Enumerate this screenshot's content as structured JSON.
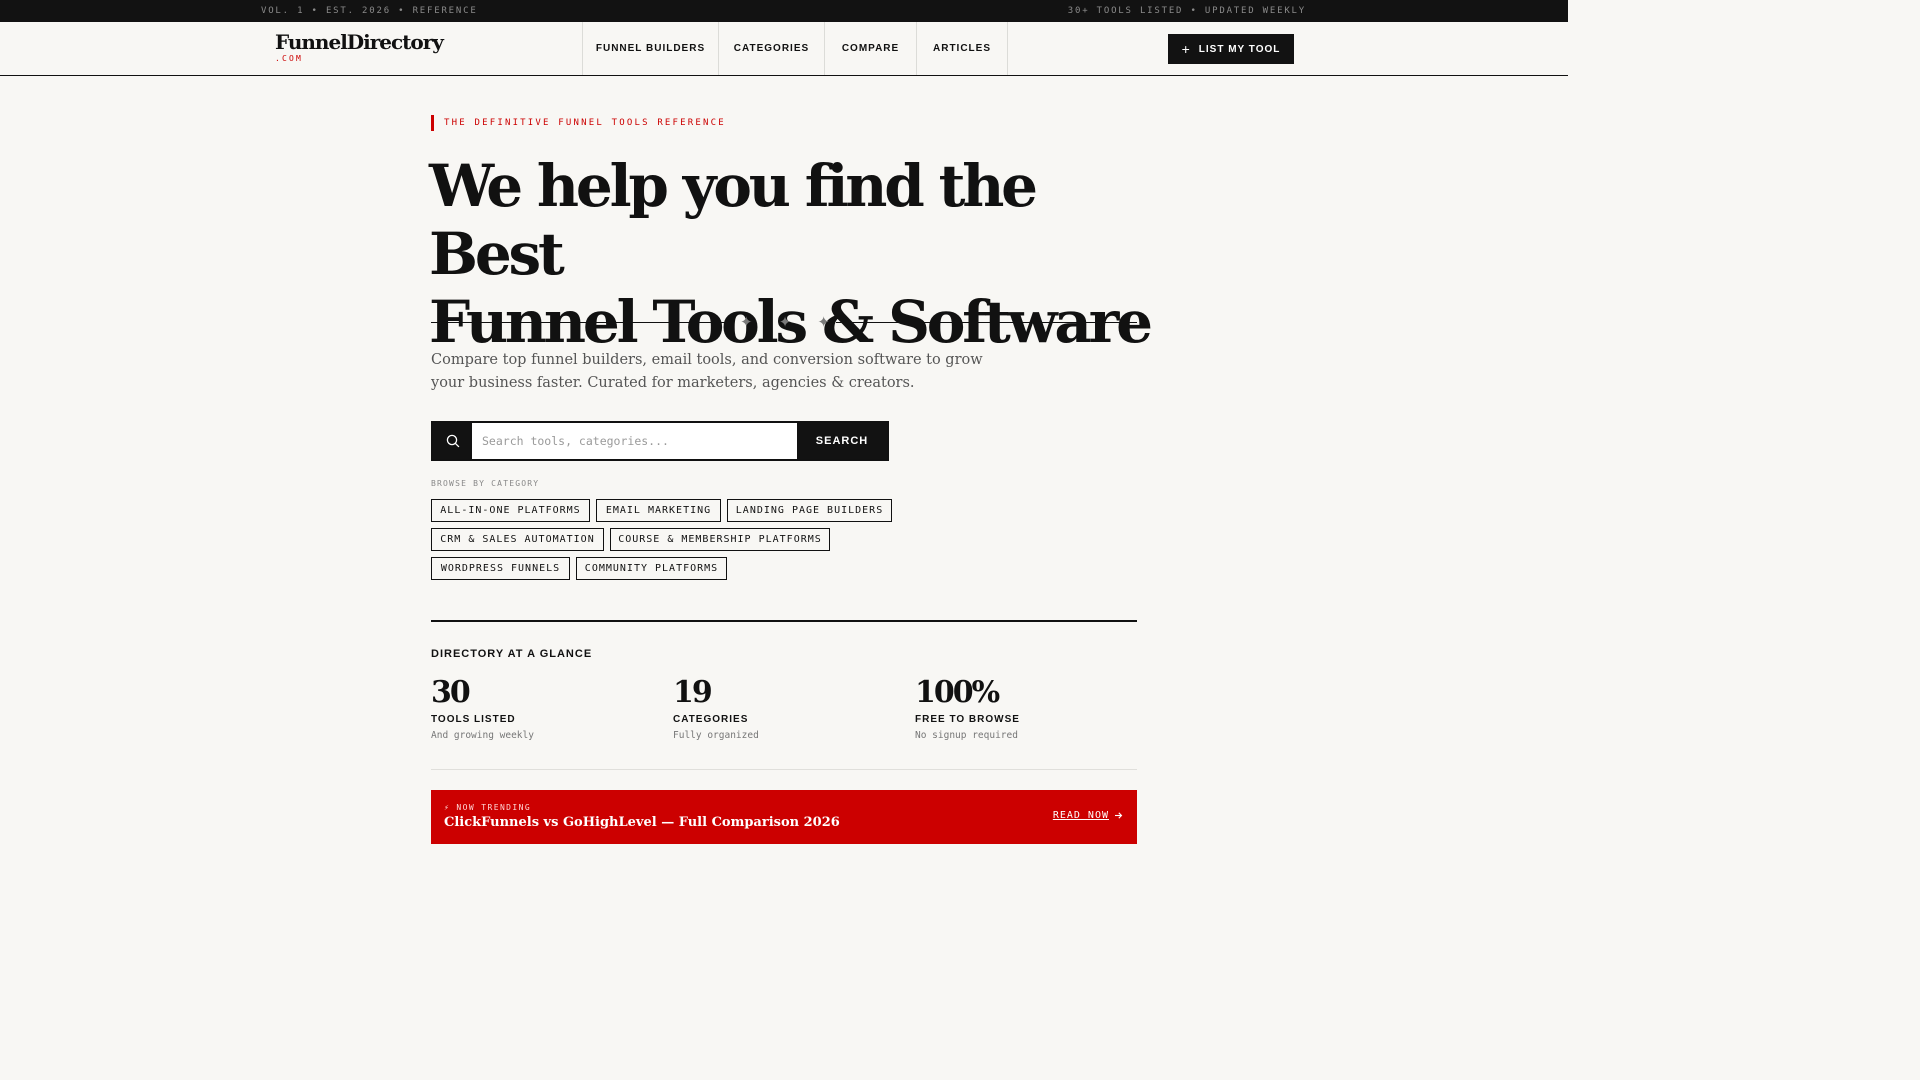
{
  "topbar": {
    "left_text": "VOL. 1 • EST. 2026 • REFERENCE",
    "right_text": "30+ TOOLS LISTED • UPDATED WEEKLY"
  },
  "logo": {
    "name": "FunnelDirectory",
    "domain": ".COM"
  },
  "nav": {
    "items": [
      {
        "label": "FUNNEL BUILDERS"
      },
      {
        "label": "CATEGORIES"
      },
      {
        "label": "COMPARE"
      },
      {
        "label": "ARTICLES"
      }
    ],
    "cta_label": "LIST MY TOOL",
    "cta_icon": "plus-icon"
  },
  "hero": {
    "eyebrow": "THE DEFINITIVE FUNNEL TOOLS REFERENCE",
    "headline_line1": "We help you find the Best",
    "headline_line2": "Funnel Tools & Software",
    "divider_glyphs": [
      "✦",
      "✦",
      "✦"
    ],
    "lede": "Compare top funnel builders, email tools, and conversion software to grow your business faster. Curated for marketers, agencies & creators."
  },
  "search": {
    "icon": "search-icon",
    "placeholder": "Search tools, categories...",
    "value": "",
    "button_label": "SEARCH"
  },
  "browse": {
    "label": "BROWSE BY CATEGORY",
    "categories": [
      "ALL-IN-ONE PLATFORMS",
      "EMAIL MARKETING",
      "LANDING PAGE BUILDERS",
      "CRM & SALES AUTOMATION",
      "COURSE & MEMBERSHIP PLATFORMS",
      "WORDPRESS FUNNELS",
      "COMMUNITY PLATFORMS"
    ]
  },
  "stats": {
    "title": "DIRECTORY AT A GLANCE",
    "items": [
      {
        "value": "30",
        "label": "TOOLS LISTED",
        "sub": "And growing weekly"
      },
      {
        "value": "19",
        "label": "CATEGORIES",
        "sub": "Fully organized"
      },
      {
        "value": "100%",
        "label": "FREE TO BROWSE",
        "sub": "No signup required"
      }
    ]
  },
  "trending": {
    "icon": "lightning-icon",
    "kicker": "⚡ NOW TRENDING",
    "title": "ClickFunnels vs GoHighLevel — Full Comparison 2026",
    "link_label": "READ NOW",
    "link_icon": "arrow-right-icon"
  },
  "colors": {
    "accent": "#cc0000",
    "ink": "#111111",
    "background": "#f8f7f4"
  }
}
